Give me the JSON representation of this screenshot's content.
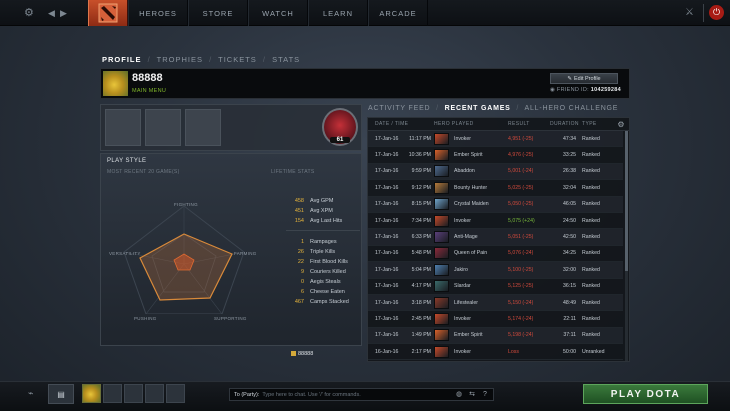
{
  "nav": {
    "items": [
      "HEROES",
      "STORE",
      "WATCH",
      "LEARN",
      "ARCADE"
    ]
  },
  "profile_tabs": {
    "items": [
      "PROFILE",
      "TROPHIES",
      "TICKETS",
      "STATS"
    ],
    "active": "PROFILE"
  },
  "player": {
    "name": "88888",
    "status": "MAIN MENU",
    "edit_label": "Edit Profile",
    "friend_id_label": "FRIEND ID:",
    "friend_id": "104259284",
    "rank_level": "61"
  },
  "play_style": {
    "title": "PLAY STYLE",
    "subtitle": "MOST RECENT 20 GAME(S)",
    "lifetime_label": "LIFETIME STATS",
    "radar_labels": {
      "fighting": "FIGHTING",
      "farming": "FARMING",
      "supporting": "SUPPORTING",
      "pushing": "PUSHING",
      "versatility": "VERSATILITY"
    },
    "stats_top": [
      {
        "value": "458",
        "label": "Avg GPM"
      },
      {
        "value": "451",
        "label": "Avg XPM"
      },
      {
        "value": "154",
        "label": "Avg Last Hits"
      }
    ],
    "stats_bottom": [
      {
        "value": "1",
        "label": "Rampages"
      },
      {
        "value": "26",
        "label": "Triple Kills"
      },
      {
        "value": "22",
        "label": "First Blood Kills"
      },
      {
        "value": "9",
        "label": "Couriers Killed"
      },
      {
        "value": "0",
        "label": "Aegis Steals"
      },
      {
        "value": "6",
        "label": "Cheese Eaten"
      },
      {
        "value": "467",
        "label": "Camps Stacked"
      }
    ],
    "footer": "88888"
  },
  "games_tabs": {
    "items": [
      "ACTIVITY FEED",
      "RECENT GAMES",
      "ALL-HERO CHALLENGE"
    ],
    "active": "RECENT GAMES"
  },
  "games": {
    "columns": [
      "DATE / TIME",
      "HERO PLAYED",
      "RESULT",
      "DURATION",
      "TYPE"
    ],
    "rows": [
      {
        "date": "17-Jan-16",
        "time": "11:17 PM",
        "hero": "Invoker",
        "result": "4,951 (-25)",
        "outcome": "loss",
        "duration": "47:34",
        "type": "Ranked",
        "hero_color": "#c44a2a"
      },
      {
        "date": "17-Jan-16",
        "time": "10:36 PM",
        "hero": "Ember Spirit",
        "result": "4,976 (-25)",
        "outcome": "loss",
        "duration": "33:25",
        "type": "Ranked",
        "hero_color": "#d8612a"
      },
      {
        "date": "17-Jan-16",
        "time": "9:59 PM",
        "hero": "Abaddon",
        "result": "5,001 (-24)",
        "outcome": "loss",
        "duration": "26:38",
        "type": "Ranked",
        "hero_color": "#4e6a8e"
      },
      {
        "date": "17-Jan-16",
        "time": "9:12 PM",
        "hero": "Bounty Hunter",
        "result": "5,025 (-25)",
        "outcome": "loss",
        "duration": "32:04",
        "type": "Ranked",
        "hero_color": "#b57a3a"
      },
      {
        "date": "17-Jan-16",
        "time": "8:15 PM",
        "hero": "Crystal Maiden",
        "result": "5,050 (-25)",
        "outcome": "loss",
        "duration": "46:05",
        "type": "Ranked",
        "hero_color": "#6fa3c9"
      },
      {
        "date": "17-Jan-16",
        "time": "7:34 PM",
        "hero": "Invoker",
        "result": "5,075 (+24)",
        "outcome": "win",
        "duration": "24:50",
        "type": "Ranked",
        "hero_color": "#c44a2a"
      },
      {
        "date": "17-Jan-16",
        "time": "6:33 PM",
        "hero": "Anti-Mage",
        "result": "5,051 (-25)",
        "outcome": "loss",
        "duration": "42:50",
        "type": "Ranked",
        "hero_color": "#5a3f7a"
      },
      {
        "date": "17-Jan-16",
        "time": "5:48 PM",
        "hero": "Queen of Pain",
        "result": "5,076 (-24)",
        "outcome": "loss",
        "duration": "34:25",
        "type": "Ranked",
        "hero_color": "#8a2a3a"
      },
      {
        "date": "17-Jan-16",
        "time": "5:04 PM",
        "hero": "Jakiro",
        "result": "5,100 (-25)",
        "outcome": "loss",
        "duration": "32:00",
        "type": "Ranked",
        "hero_color": "#4f7fae"
      },
      {
        "date": "17-Jan-16",
        "time": "4:17 PM",
        "hero": "Slardar",
        "result": "5,125 (-25)",
        "outcome": "loss",
        "duration": "36:15",
        "type": "Ranked",
        "hero_color": "#3a6a6a"
      },
      {
        "date": "17-Jan-16",
        "time": "3:18 PM",
        "hero": "Lifestealer",
        "result": "5,150 (-24)",
        "outcome": "loss",
        "duration": "48:49",
        "type": "Ranked",
        "hero_color": "#8a3a2a"
      },
      {
        "date": "17-Jan-16",
        "time": "2:45 PM",
        "hero": "Invoker",
        "result": "5,174 (-24)",
        "outcome": "loss",
        "duration": "22:11",
        "type": "Ranked",
        "hero_color": "#c44a2a"
      },
      {
        "date": "17-Jan-16",
        "time": "1:49 PM",
        "hero": "Ember Spirit",
        "result": "5,198 (-24)",
        "outcome": "loss",
        "duration": "37:11",
        "type": "Ranked",
        "hero_color": "#d8612a"
      },
      {
        "date": "16-Jan-16",
        "time": "2:17 PM",
        "hero": "Invoker",
        "result": "Loss",
        "outcome": "loss",
        "duration": "50:00",
        "type": "Unranked",
        "hero_color": "#c44a2a"
      }
    ]
  },
  "chat": {
    "label": "To (Party):",
    "placeholder": "Type here to chat. Use '/' for commands."
  },
  "play_button": "PLAY DOTA",
  "colors": {
    "accent_orange": "#c8502a",
    "gold": "#e3b23c",
    "loss": "#d24a3c",
    "win": "#78b83b",
    "play_green": "#3b7a3c"
  }
}
